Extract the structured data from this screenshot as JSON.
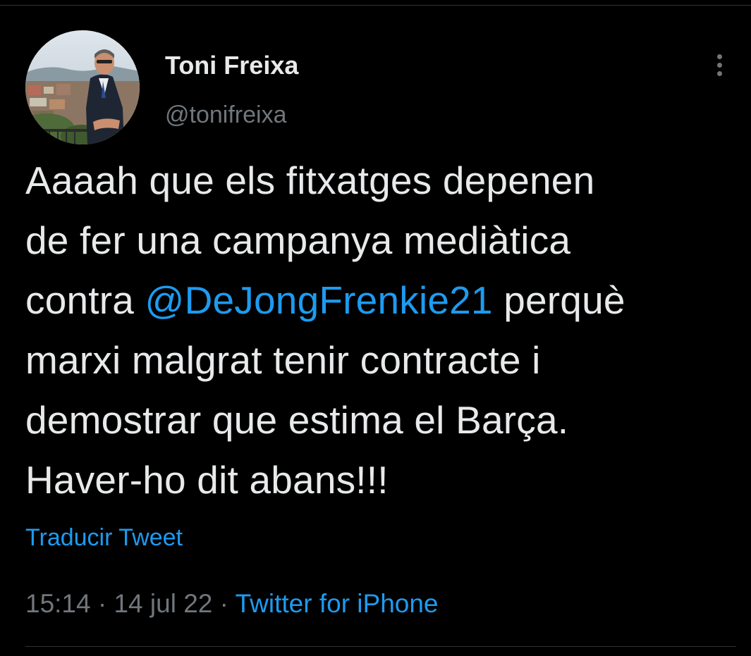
{
  "tweet": {
    "author": {
      "name": "Toni Freixa",
      "handle": "@tonifreixa",
      "avatar_icon": "profile-photo"
    },
    "more_icon": "more-vertical-icon",
    "text_before_mention": "Aaaah que els fitxatges depenen\nde fer una campanya mediàtica\ncontra ",
    "mention": "@DeJongFrenkie21",
    "text_after_mention": " perquè\nmarxi malgrat tenir contracte i\ndemostrar que estima el Barça.\nHaver-ho dit abans!!!",
    "translate_label": "Traducir Tweet",
    "time": "15:14",
    "separator": " · ",
    "date": "14 jul 22",
    "source": "Twitter for iPhone"
  },
  "colors": {
    "background": "#000000",
    "text_primary": "#e7e9ea",
    "text_secondary": "#71767b",
    "accent": "#1d9bf0",
    "divider": "#2f3336"
  }
}
